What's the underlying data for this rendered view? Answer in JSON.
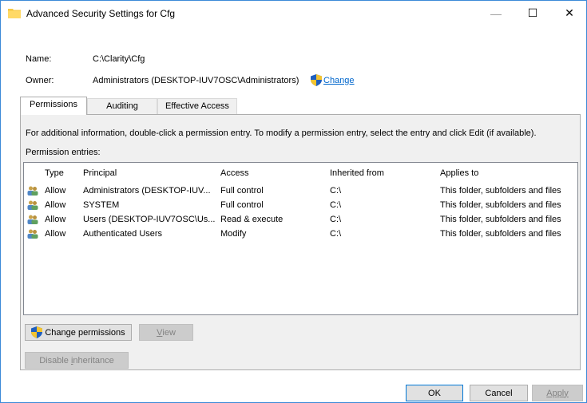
{
  "window": {
    "title": "Advanced Security Settings for Cfg",
    "minimize_glyph": "—",
    "maximize_glyph": "☐",
    "close_glyph": "✕"
  },
  "info": {
    "name_label": "Name:",
    "name_value": "C:\\Clarity\\Cfg",
    "owner_label": "Owner:",
    "owner_value": "Administrators (DESKTOP-IUV7OSC\\Administrators)",
    "owner_change_link": "Change"
  },
  "tabs": [
    {
      "label": "Permissions",
      "active": true
    },
    {
      "label": "Auditing",
      "active": false
    },
    {
      "label": "Effective Access",
      "active": false
    }
  ],
  "permissions": {
    "info_text": "For additional information, double-click a permission entry. To modify a permission entry, select the entry and click Edit (if available).",
    "entries_label": "Permission entries:",
    "columns": [
      "Type",
      "Principal",
      "Access",
      "Inherited from",
      "Applies to"
    ],
    "rows": [
      [
        "Allow",
        "Administrators (DESKTOP-IUV...",
        "Full control",
        "C:\\",
        "This folder, subfolders and files"
      ],
      [
        "Allow",
        "SYSTEM",
        "Full control",
        "C:\\",
        "This folder, subfolders and files"
      ],
      [
        "Allow",
        "Users (DESKTOP-IUV7OSC\\Us...",
        "Read & execute",
        "C:\\",
        "This folder, subfolders and files"
      ],
      [
        "Allow",
        "Authenticated Users",
        "Modify",
        "C:\\",
        "This folder, subfolders and files"
      ]
    ],
    "change_permissions_label": "Change permissions",
    "view_label_pre": "",
    "view_label_u": "V",
    "view_label_post": "iew",
    "disable_inheritance_pre": "Disable ",
    "disable_inheritance_u": "i",
    "disable_inheritance_post": "nheritance"
  },
  "footer": {
    "ok_label": "OK",
    "cancel_label": "Cancel",
    "apply_label": "Apply"
  },
  "colors": {
    "accent": "#0078d7",
    "link": "#0066cc",
    "border": "#3c8ad8"
  }
}
